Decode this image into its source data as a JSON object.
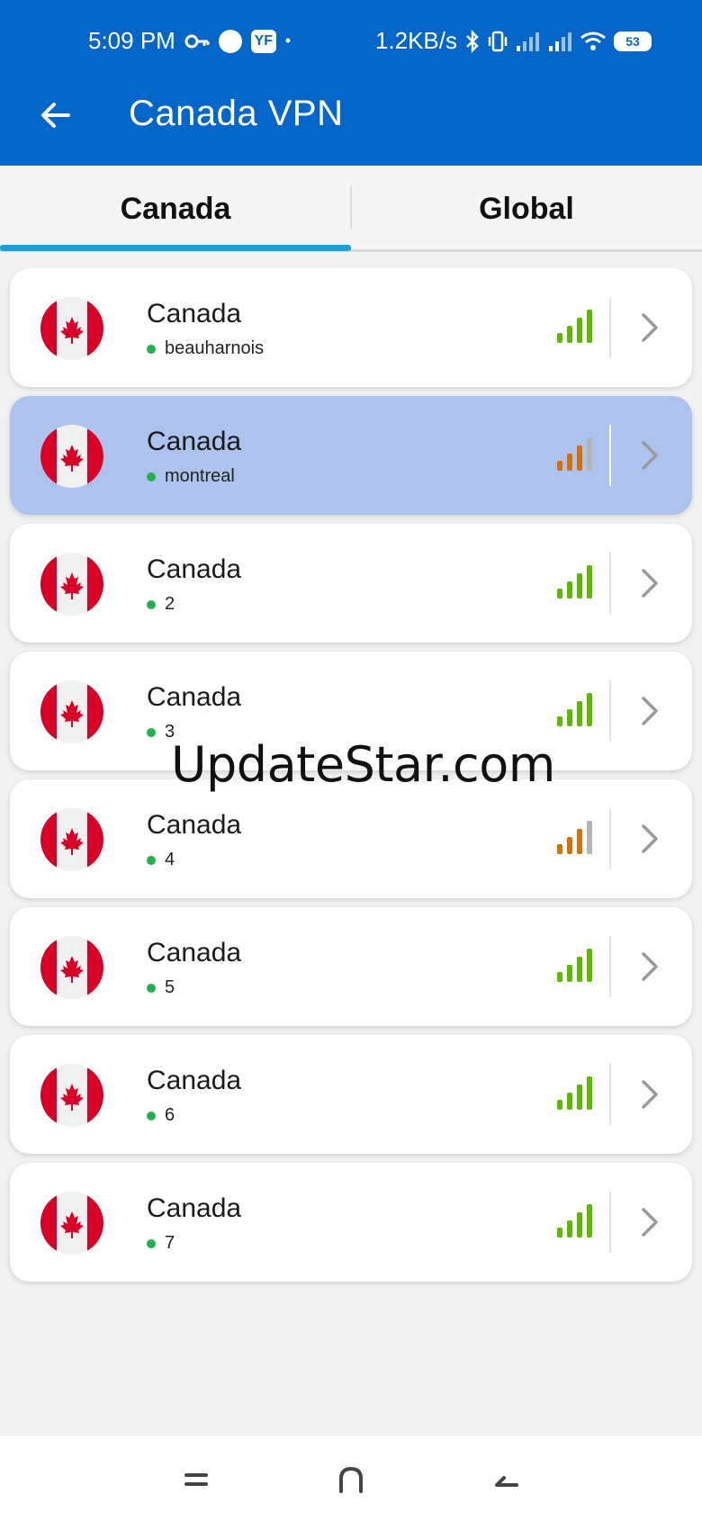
{
  "status_bar": {
    "time": "5:09 PM",
    "speed": "1.2KB/s",
    "battery": "53",
    "icons": [
      "key-icon",
      "circle-icon",
      "app-badge-icon",
      "dot-icon",
      "bluetooth-icon",
      "vibrate-icon",
      "signal-icon",
      "signal-icon",
      "wifi-icon",
      "battery-icon"
    ],
    "badge_text": "YF"
  },
  "app_bar": {
    "title": "Canada VPN",
    "back_icon": "back-arrow-icon"
  },
  "tabs": [
    {
      "label": "Canada",
      "active": true
    },
    {
      "label": "Global",
      "active": false
    }
  ],
  "servers": [
    {
      "country": "Canada",
      "location": "beauharnois",
      "signal": "green",
      "selected": false
    },
    {
      "country": "Canada",
      "location": "montreal",
      "signal": "orange",
      "selected": true
    },
    {
      "country": "Canada",
      "location": "2",
      "signal": "green",
      "selected": false
    },
    {
      "country": "Canada",
      "location": "3",
      "signal": "green",
      "selected": false
    },
    {
      "country": "Canada",
      "location": "4",
      "signal": "orange",
      "selected": false
    },
    {
      "country": "Canada",
      "location": "5",
      "signal": "green",
      "selected": false
    },
    {
      "country": "Canada",
      "location": "6",
      "signal": "green",
      "selected": false
    },
    {
      "country": "Canada",
      "location": "7",
      "signal": "green",
      "selected": false
    }
  ],
  "watermark": "UpdateStar.com",
  "colors": {
    "primary": "#0466c8",
    "tab_indicator": "#1e9fd6",
    "selected_card": "#adc2ec",
    "signal_green": "#5cb800",
    "signal_orange": "#d4700a",
    "online_dot": "#22b14c",
    "flag_red": "#d80027"
  },
  "nav_bar": {
    "buttons": [
      "menu-icon",
      "home-icon",
      "back-icon"
    ]
  }
}
